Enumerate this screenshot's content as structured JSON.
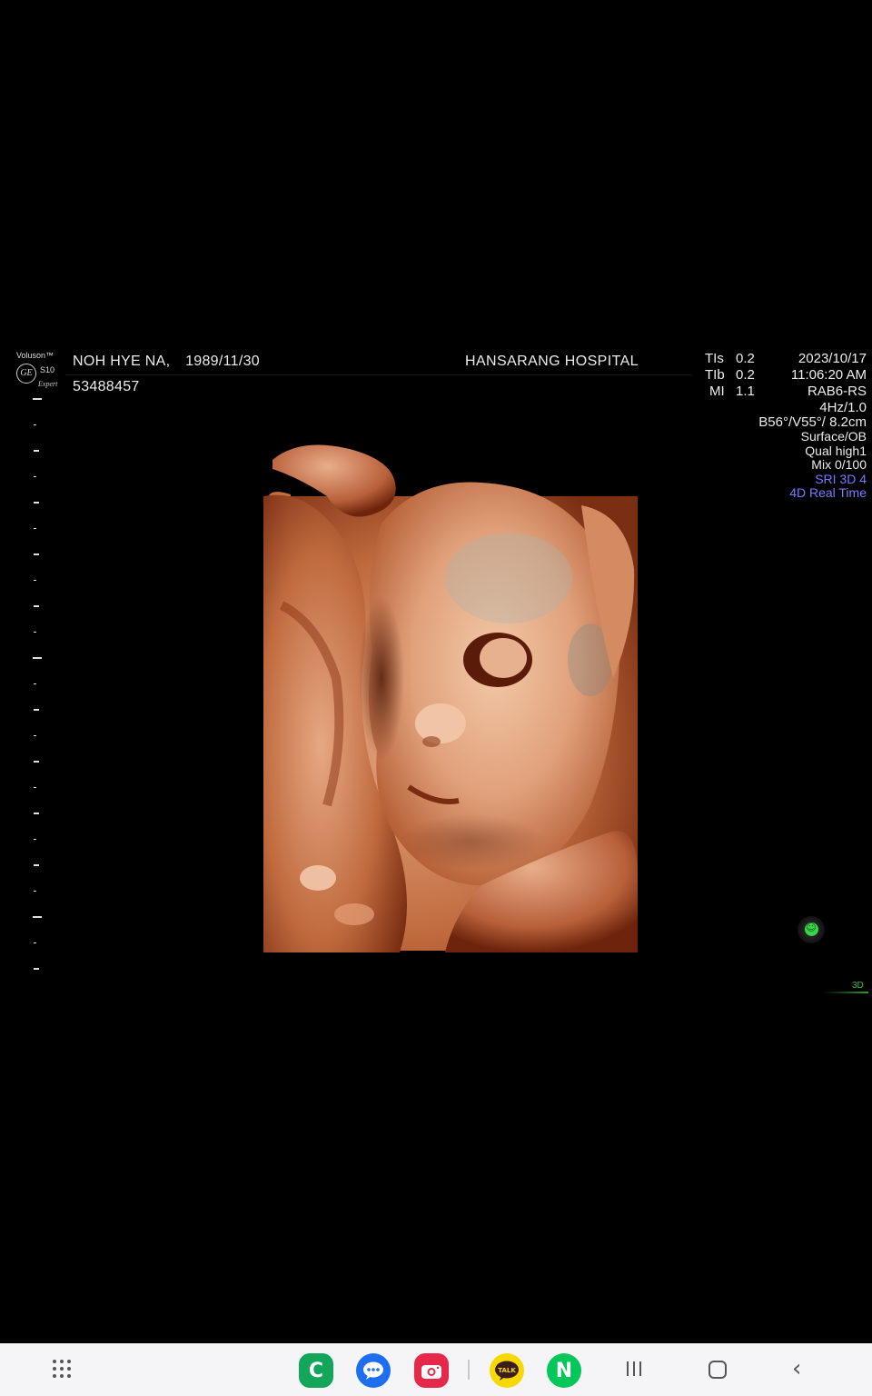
{
  "device": {
    "brand": "Voluson™",
    "maker_logo": "GE",
    "model": "S10",
    "model_suffix": "Expert"
  },
  "patient": {
    "name": "NOH HYE NA,",
    "dob": "1989/11/30",
    "id": "53488457"
  },
  "hospital": "HANSARANG HOSPITAL",
  "params": [
    {
      "key": "TIs",
      "value": "0.2"
    },
    {
      "key": "TIb",
      "value": "0.2"
    },
    {
      "key": "MI",
      "value": "1.1"
    }
  ],
  "datetime": {
    "date": "2023/10/17",
    "time": "11:06:20 AM",
    "probe": "RAB6-RS"
  },
  "settings": {
    "frequency": "4Hz/1.0",
    "angles": "B56°/V55°/ 8.2cm",
    "mode": "Surface/OB",
    "quality": "Qual high1",
    "mix": "Mix 0/100",
    "sri": "SRI 3D 4",
    "realtime": "4D Real Time"
  },
  "indicator_label": "3D",
  "colors": {
    "background": "#000000",
    "text": "#ececec",
    "blue_setting": "#7a7aff",
    "indicator_green": "#38d64a",
    "skin_tone": "#d98a5a",
    "navbar": "#f5f5f7"
  },
  "navbar": {
    "apps": [
      {
        "name": "phone-app",
        "icon": "C"
      },
      {
        "name": "messages-app",
        "icon": "chat-bubble"
      },
      {
        "name": "camera-app",
        "icon": "camera"
      },
      {
        "name": "kakaotalk-app",
        "icon": "TALK"
      },
      {
        "name": "naver-app",
        "icon": "N"
      }
    ]
  }
}
